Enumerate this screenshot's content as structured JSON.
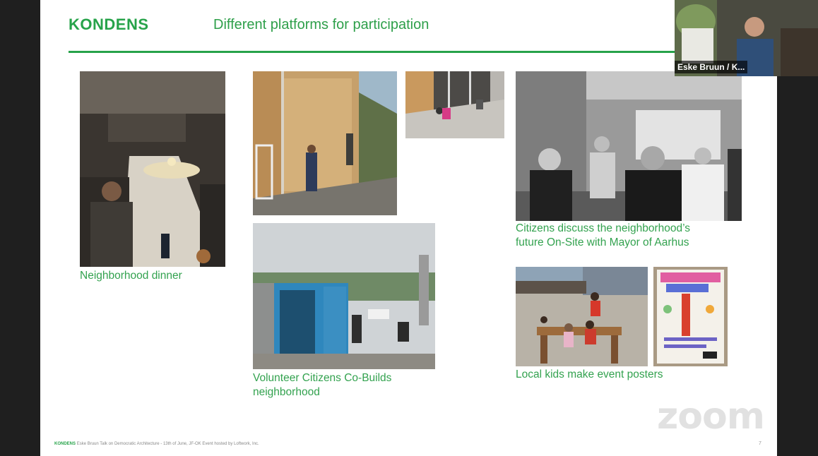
{
  "slide": {
    "brand": "KONDENS",
    "title": "Different platforms for participation",
    "page_number": "7",
    "footer_brand": "KONDENS",
    "footer_text": "Eske Bruun Talk on Democratic Architecture - 13th of June, JF-OK Event hosted by Loftwork, Inc."
  },
  "captions": {
    "dinner": "Neighborhood dinner",
    "cobuild_line1": "Volunteer Citizens Co-Builds",
    "cobuild_line2": "neighborhood",
    "mayor_line1": "Citizens discuss the neighborhood’s",
    "mayor_line2": "future On-Site with Mayor of Aarhus",
    "kids": "Local kids make event posters"
  },
  "video": {
    "participant_name": "Eske Bruun / K..."
  },
  "watermark": "zoom",
  "colors": {
    "accent": "#27a34a",
    "caption": "#33a24f",
    "background": "#1f1f1f"
  }
}
